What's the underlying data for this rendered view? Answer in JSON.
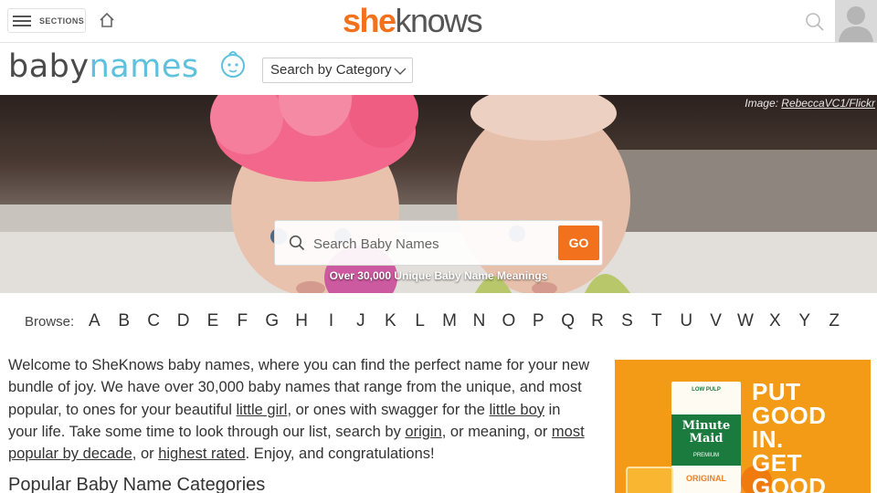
{
  "topbar": {
    "sections_label": "SECTIONS",
    "brand_she": "she",
    "brand_knows": "knows"
  },
  "subheader": {
    "logo_baby": "baby",
    "logo_names": "names",
    "category_select": "Search by Category"
  },
  "hero": {
    "credit_prefix": "Image: ",
    "credit_link": "RebeccaVC1/Flickr",
    "search_placeholder": "Search Baby Names",
    "go_label": "GO",
    "tagline": "Over 30,000 Unique Baby Name Meanings"
  },
  "browse": {
    "label": "Browse:",
    "letters": [
      "A",
      "B",
      "C",
      "D",
      "E",
      "F",
      "G",
      "H",
      "I",
      "J",
      "K",
      "L",
      "M",
      "N",
      "O",
      "P",
      "Q",
      "R",
      "S",
      "T",
      "U",
      "V",
      "W",
      "X",
      "Y",
      "Z"
    ]
  },
  "intro": {
    "p1": "Welcome to SheKnows baby names, where you can find the perfect name for your new bundle of joy. We have over 30,000 baby names that range from the unique, and most popular, to ones for your beautiful ",
    "link_girl": "little girl",
    "p2": ", or ones with swagger for the ",
    "link_boy": "little boy",
    "p3": " in your life. Take some time to look through our list, search by ",
    "link_origin": "origin",
    "p4": ", or meaning, or ",
    "link_decade": "most popular by decade",
    "p5": ", or ",
    "link_rated": "highest rated",
    "p6": ". Enjoy, and congratulations!"
  },
  "popular_heading": "Popular Baby Name Categories",
  "ad": {
    "carton_top": "LOW PULP",
    "brand": "Minute Maid",
    "brand_sub": "PREMIUM",
    "original": "ORIGINAL",
    "line1": "PUT",
    "line2": "GOOD",
    "line3": "IN.",
    "line4": "GET",
    "line5": "GOOD"
  },
  "colors": {
    "accent": "#f2711c",
    "logo_blue": "#5ec1dd",
    "ad_orange": "#f39a16"
  }
}
